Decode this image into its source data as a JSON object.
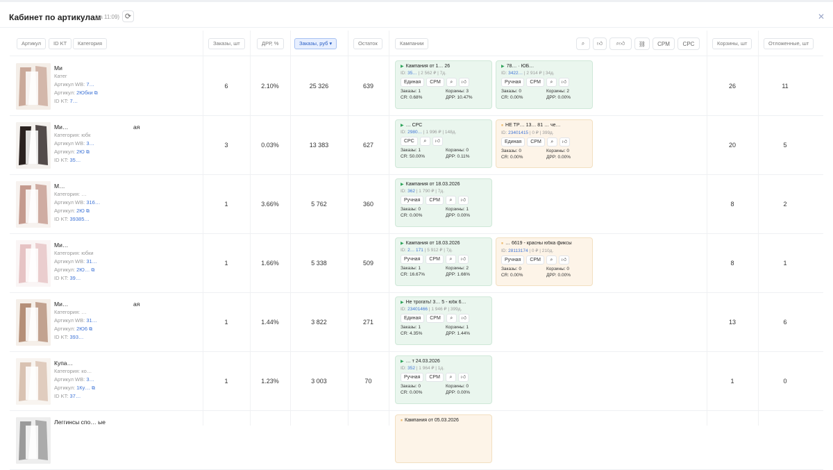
{
  "header": {
    "title": "Кабинет по артикулам",
    "subtitle": "(за 11:09)",
    "refresh_icon": "refresh-icon",
    "close_icon": "close-icon"
  },
  "filters": {
    "article": "Артикул",
    "id_kt": "ID KT",
    "category": "Категория",
    "orders_qty": "Заказы, шт",
    "drr": "ДРР, %",
    "orders_rub": "Заказы, руб",
    "stock": "Остаток",
    "campaigns": "Кампании",
    "cpm": "CPM",
    "cpc": "CPC",
    "baskets": "Корзины, шт",
    "postponed": "Отложенные, шт"
  },
  "rows": [
    {
      "name": "Ми",
      "category": "Катег",
      "article_wb_label": "Артикул WB:",
      "article_wb": "7…",
      "article_label": "Артикул:",
      "article": "2Юбки",
      "idkt_label": "ID KT:",
      "idkt": "7…",
      "orders": "6",
      "drr": "2.10%",
      "orders_rub": "25 326",
      "stock": "639",
      "baskets": "26",
      "postponed": "11",
      "campaigns": [
        {
          "color": "green",
          "status": "▶",
          "title": "Кампания от 1… 26",
          "id": "35…",
          "meta": "2 562 ₽ | 7д.",
          "tags": [
            "Единая",
            "CPM"
          ],
          "o": "Заказы: 1",
          "b": "Корзины: 3",
          "cr": "CR: 0.68%",
          "d": "ДРР: 10.47%"
        },
        {
          "color": "green",
          "status": "▶",
          "title": "78… · ЮБ…",
          "id": "3422…",
          "meta": "2 914 ₽ | 34д.",
          "tags": [
            "Ручная",
            "CPM"
          ],
          "o": "Заказы: 0",
          "b": "Корзины: 2",
          "cr": "CR: 0.00%",
          "d": "ДРР: 0.00%"
        }
      ]
    },
    {
      "name": "Ми…",
      "extra": "ая",
      "category": "Категория: юбк",
      "article_wb_label": "Артикул WB:",
      "article_wb": "3…",
      "article_label": "Артикул:",
      "article": "2Ю",
      "idkt_label": "ID KT:",
      "idkt": "35…",
      "orders": "3",
      "drr": "0.03%",
      "orders_rub": "13 383",
      "stock": "627",
      "baskets": "20",
      "postponed": "5",
      "campaigns": [
        {
          "color": "green",
          "status": "▶",
          "title": "… CPC",
          "id": "2980…",
          "meta": "1 996 ₽ | 148д.",
          "tags": [
            "CPC"
          ],
          "o": "Заказы: 1",
          "b": "Корзины: 0",
          "cr": "CR: 50.00%",
          "d": "ДРР: 0.11%"
        },
        {
          "color": "orange",
          "status": "⏸",
          "title": "НЕ ТР… 13… 81 … че…",
          "id": "23401415",
          "meta": "0 ₽ | 399д.",
          "tags": [
            "Единая",
            "CPM"
          ],
          "o": "Заказы: 0",
          "b": "Корзины: 0",
          "cr": "CR: 0.00%",
          "d": "ДРР: 0.00%"
        }
      ]
    },
    {
      "name": "М…",
      "category": "Категория: …",
      "article_wb_label": "Артикул WB:",
      "article_wb": "316…",
      "article_label": "Артикул:",
      "article": "2Ю",
      "idkt_label": "ID KT:",
      "idkt": "39385…",
      "orders": "1",
      "drr": "3.66%",
      "orders_rub": "5 762",
      "stock": "360",
      "baskets": "8",
      "postponed": "2",
      "campaigns": [
        {
          "color": "green",
          "status": "▶",
          "title": "Кампания от 18.03.2026",
          "id": "362",
          "meta": "1 790 ₽ | 7д.",
          "tags": [
            "Ручная",
            "CPM"
          ],
          "o": "Заказы: 0",
          "b": "Корзины: 1",
          "cr": "CR: 0.00%",
          "d": "ДРР: 0.00%"
        }
      ]
    },
    {
      "name": "Ми…",
      "category": "Категория: юбки",
      "article_wb_label": "Артикул WB:",
      "article_wb": "31…",
      "article_label": "Артикул:",
      "article": "2Ю…",
      "idkt_label": "ID KT:",
      "idkt": "39…",
      "orders": "1",
      "drr": "1.66%",
      "orders_rub": "5 338",
      "stock": "509",
      "baskets": "8",
      "postponed": "1",
      "campaigns": [
        {
          "color": "green",
          "status": "▶",
          "title": "Кампания от 18.03.2026",
          "id": "2… 171",
          "meta": "5 912 ₽ | 7д.",
          "tags": [
            "Ручная",
            "CPM"
          ],
          "o": "Заказы: 1",
          "b": "Корзины: 2",
          "cr": "CR: 16.67%",
          "d": "ДРР: 1.66%"
        },
        {
          "color": "orange",
          "status": "⏸",
          "title": "… 6619 - красны юбка фиксы",
          "id": "28113174",
          "meta": "0 ₽ | 210д.",
          "tags": [
            "Ручная",
            "CPM"
          ],
          "o": "Заказы: 0",
          "b": "Корзины: 0",
          "cr": "CR: 0.00%",
          "d": "ДРР: 0.00%"
        }
      ]
    },
    {
      "name": "Ми…",
      "extra": "ая",
      "category": "Категория: …",
      "article_wb_label": "Артикул WB:",
      "article_wb": "31…",
      "article_label": "Артикул:",
      "article": "2Ю6",
      "idkt_label": "ID KT:",
      "idkt": "393…",
      "orders": "1",
      "drr": "1.44%",
      "orders_rub": "3 822",
      "stock": "271",
      "baskets": "13",
      "postponed": "6",
      "campaigns": [
        {
          "color": "green",
          "status": "▶",
          "title": "Не трогать! 3… 5 - юбк 6…",
          "id": "23401466",
          "meta": "1 946 ₽ | 399д.",
          "tags": [
            "Единая",
            "CPM"
          ],
          "o": "Заказы: 1",
          "b": "Корзины: 1",
          "cr": "CR: 4.35%",
          "d": "ДРР: 1.44%"
        }
      ]
    },
    {
      "name": "Купа…",
      "category": "Категория: ко…",
      "article_wb_label": "Артикул WB:",
      "article_wb": "3…",
      "article_label": "Артикул:",
      "article": "1Ку…",
      "idkt_label": "ID KT:",
      "idkt": "37…",
      "orders": "1",
      "drr": "1.23%",
      "orders_rub": "3 003",
      "stock": "70",
      "baskets": "1",
      "postponed": "0",
      "campaigns": [
        {
          "color": "green",
          "status": "▶",
          "title": "… т 24.03.2026",
          "id": "352",
          "meta": "1 964 ₽ | 1д.",
          "tags": [
            "Ручная",
            "CPM"
          ],
          "o": "Заказы: 0",
          "b": "Корзины: 0",
          "cr": "CR: 0.00%",
          "d": "ДРР: 0.00%"
        }
      ]
    },
    {
      "name": "Леггинсы спо… ые",
      "campaigns": [
        {
          "color": "orange",
          "status": "⏸",
          "title": "Кампания от 05.03.2026"
        }
      ]
    }
  ]
}
